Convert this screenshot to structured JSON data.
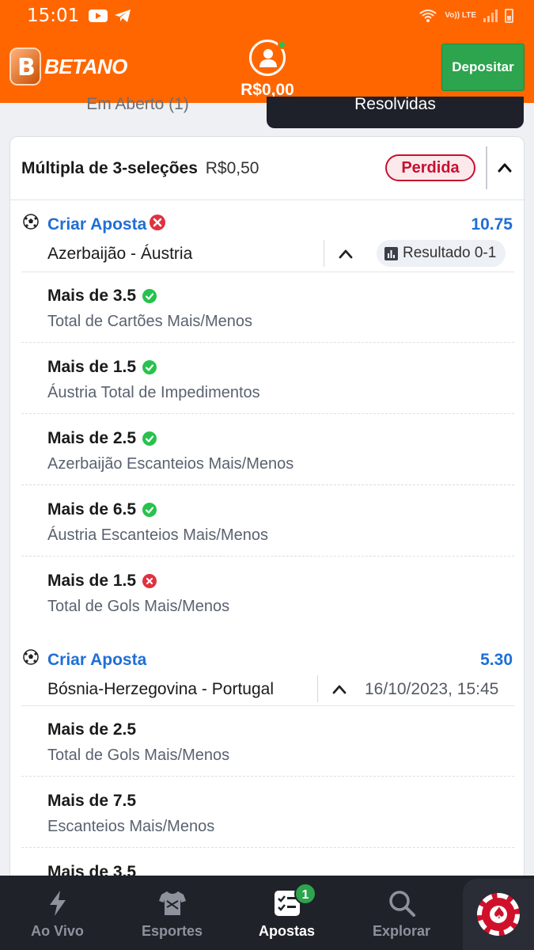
{
  "status_bar": {
    "time": "15:01",
    "network": "Vo)) LTE"
  },
  "header": {
    "brand": "BETANO",
    "balance": "R$0,00",
    "deposit_label": "Depositar"
  },
  "tabs": {
    "open_label": "Em Aberto (1)",
    "resolved_label": "Resolvidas"
  },
  "bet": {
    "type_label": "Múltipla de 3-seleções",
    "stake": "R$0,50",
    "status": "Perdida",
    "events": [
      {
        "label": "Criar Aposta",
        "odds": "10.75",
        "match": "Azerbaijão - Áustria",
        "result": "Resultado 0-1",
        "selections": [
          {
            "title": "Mais de 3.5",
            "market": "Total de Cartões Mais/Menos",
            "outcome": "won"
          },
          {
            "title": "Mais de 1.5",
            "market": "Áustria Total de Impedimentos",
            "outcome": "won"
          },
          {
            "title": "Mais de 2.5",
            "market": "Azerbaijão Escanteios Mais/Menos",
            "outcome": "won"
          },
          {
            "title": "Mais de 6.5",
            "market": "Áustria Escanteios Mais/Menos",
            "outcome": "won"
          },
          {
            "title": "Mais de 1.5",
            "market": "Total de Gols Mais/Menos",
            "outcome": "lost"
          }
        ]
      },
      {
        "label": "Criar Aposta",
        "odds": "5.30",
        "match": "Bósnia-Herzegovina - Portugal",
        "datetime": "16/10/2023, 15:45",
        "selections": [
          {
            "title": "Mais de 2.5",
            "market": "Total de Gols Mais/Menos"
          },
          {
            "title": "Mais de 7.5",
            "market": "Escanteios Mais/Menos"
          },
          {
            "title": "Mais de 3.5",
            "market": ""
          }
        ]
      }
    ]
  },
  "bottom_nav": {
    "items": [
      {
        "label": "Ao Vivo",
        "icon": "lightning-icon"
      },
      {
        "label": "Esportes",
        "icon": "jersey-icon"
      },
      {
        "label": "Apostas",
        "icon": "betslip-icon",
        "badge": "1",
        "active": true
      },
      {
        "label": "Explorar",
        "icon": "search-icon"
      }
    ]
  },
  "colors": {
    "brand": "#ff6600",
    "deposit": "#2da44e",
    "link": "#1f6fd6",
    "lost": "#c8102e",
    "won": "#27c24c"
  }
}
